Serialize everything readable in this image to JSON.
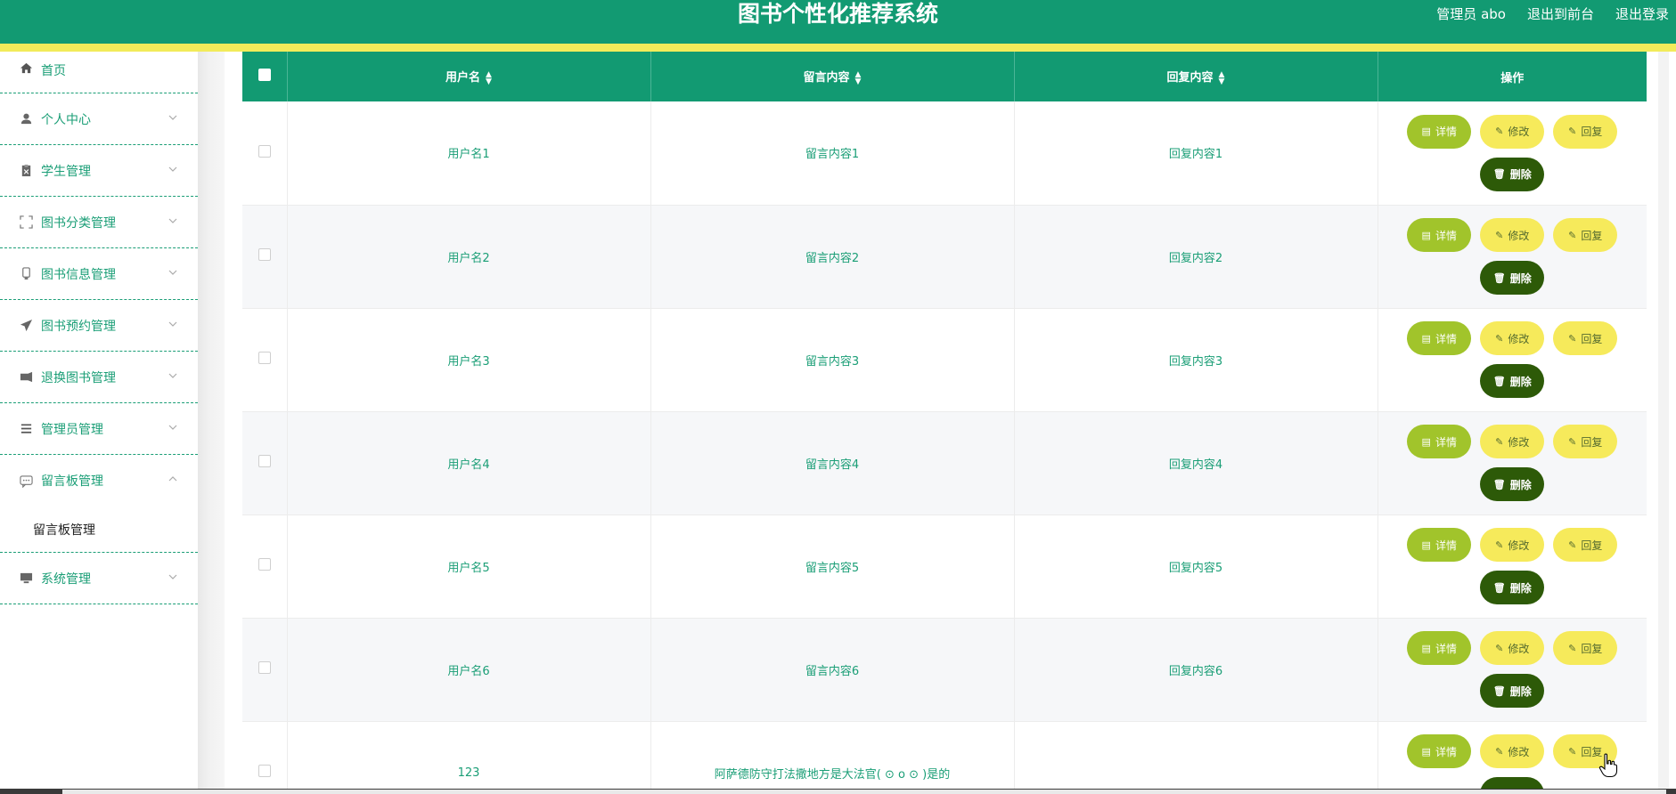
{
  "header": {
    "title": "图书个性化推荐系统",
    "user_label": "管理员 abo",
    "links": [
      "退出到前台",
      "退出登录"
    ],
    "bg_color": "#129a72",
    "stripe_color": "#f2eb5a"
  },
  "sidebar": {
    "items": [
      {
        "label": "首页",
        "icon": "home-icon"
      },
      {
        "label": "个人中心",
        "icon": "user-icon"
      },
      {
        "label": "学生管理",
        "icon": "clipboard-icon"
      },
      {
        "label": "图书分类管理",
        "icon": "frame-icon"
      },
      {
        "label": "图书信息管理",
        "icon": "book-icon"
      },
      {
        "label": "图书预约管理",
        "icon": "send-icon"
      },
      {
        "label": "退换图书管理",
        "icon": "ticket-icon"
      },
      {
        "label": "管理员管理",
        "icon": "menu-lines-icon"
      },
      {
        "label": "留言板管理",
        "icon": "chat-icon",
        "open": true,
        "children": [
          "留言板管理"
        ]
      },
      {
        "label": "系统管理",
        "icon": "monitor-icon"
      }
    ]
  },
  "table": {
    "columns": [
      "用户名",
      "留言内容",
      "回复内容",
      "操作"
    ],
    "rows": [
      {
        "username": "用户名1",
        "message": "留言内容1",
        "reply": "回复内容1"
      },
      {
        "username": "用户名2",
        "message": "留言内容2",
        "reply": "回复内容2"
      },
      {
        "username": "用户名3",
        "message": "留言内容3",
        "reply": "回复内容3"
      },
      {
        "username": "用户名4",
        "message": "留言内容4",
        "reply": "回复内容4"
      },
      {
        "username": "用户名5",
        "message": "留言内容5",
        "reply": "回复内容5"
      },
      {
        "username": "用户名6",
        "message": "留言内容6",
        "reply": "回复内容6"
      },
      {
        "username": "123",
        "message": "阿萨德防守打法撒地方是大法官( ⊙ o ⊙ )是的",
        "reply": ""
      }
    ],
    "actions": {
      "detail": "详情",
      "edit": "修改",
      "reply": "回复",
      "delete": "删除"
    }
  }
}
